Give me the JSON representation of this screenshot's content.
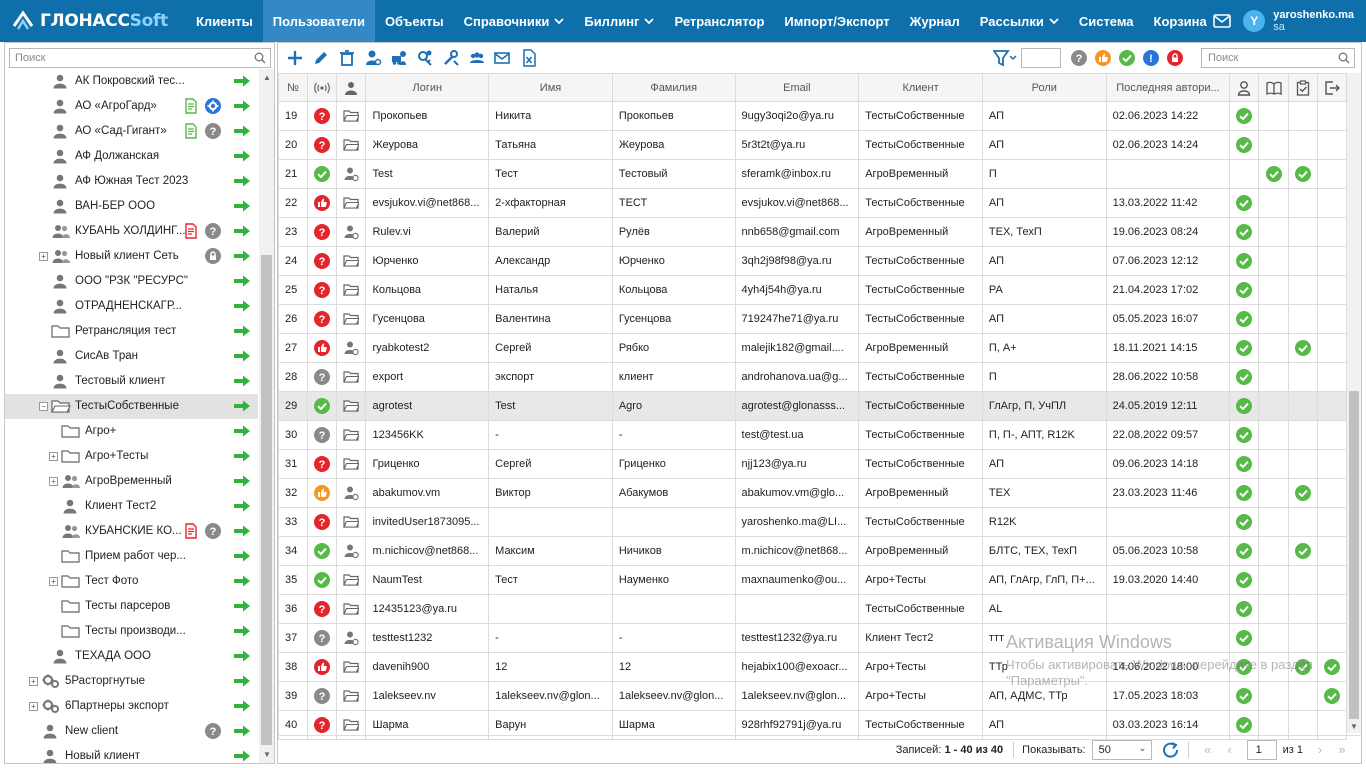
{
  "app": {
    "logo_main": "ГЛОНАСС",
    "logo_soft": "Soft"
  },
  "nav": [
    {
      "label": "Клиенты",
      "active": false,
      "caret": false
    },
    {
      "label": "Пользователи",
      "active": true,
      "caret": false
    },
    {
      "label": "Объекты",
      "active": false,
      "caret": false
    },
    {
      "label": "Справочники",
      "active": false,
      "caret": true
    },
    {
      "label": "Биллинг",
      "active": false,
      "caret": true
    },
    {
      "label": "Ретранслятор",
      "active": false,
      "caret": false
    },
    {
      "label": "Импорт/Экспорт",
      "active": false,
      "caret": false
    },
    {
      "label": "Журнал",
      "active": false,
      "caret": false
    },
    {
      "label": "Рассылки",
      "active": false,
      "caret": true
    },
    {
      "label": "Система",
      "active": false,
      "caret": false
    },
    {
      "label": "Корзина",
      "active": false,
      "caret": false
    }
  ],
  "user": {
    "initial": "Y",
    "name": "yaroshenko.ma",
    "role": "sa"
  },
  "sidebar": {
    "search_placeholder": "Поиск",
    "tree": [
      {
        "label": "АК Покровский тес...",
        "level": 1,
        "icon": "user-gray",
        "expander": "",
        "badges": []
      },
      {
        "label": "АО «АгроГард»",
        "level": 1,
        "icon": "user-gray",
        "expander": "",
        "badges": [
          "doc-green",
          "gear-blue"
        ]
      },
      {
        "label": "АО «Сад-Гигант»",
        "level": 1,
        "icon": "user-gray",
        "expander": "",
        "badges": [
          "doc-green",
          "question-gray"
        ]
      },
      {
        "label": "АФ Должанская",
        "level": 1,
        "icon": "user-gray",
        "expander": "",
        "badges": []
      },
      {
        "label": "АФ Южная Тест 2023",
        "level": 1,
        "icon": "user-gray",
        "expander": "",
        "badges": []
      },
      {
        "label": "ВАН-БЕР ООО",
        "level": 1,
        "icon": "user-gray",
        "expander": "",
        "badges": []
      },
      {
        "label": "КУБАНЬ ХОЛДИНГ...",
        "level": 1,
        "icon": "users-gray",
        "expander": "",
        "badges": [
          "doc-red",
          "question-gray"
        ]
      },
      {
        "label": "Новый клиент Сеть",
        "level": 1,
        "icon": "users-gray",
        "expander": "+",
        "badges": [
          "lock-gray"
        ]
      },
      {
        "label": "ООО \"РЗК \"РЕСУРС\"",
        "level": 1,
        "icon": "user-gray",
        "expander": "",
        "badges": []
      },
      {
        "label": "ОТРАДНЕНСКАГР...",
        "level": 1,
        "icon": "user-gray",
        "expander": "",
        "badges": []
      },
      {
        "label": "Ретрансляция тест",
        "level": 1,
        "icon": "folder",
        "expander": "",
        "badges": []
      },
      {
        "label": "СисАв Тран",
        "level": 1,
        "icon": "user-gray",
        "expander": "",
        "badges": []
      },
      {
        "label": "Тестовый клиент",
        "level": 1,
        "icon": "user-gray",
        "expander": "",
        "badges": []
      },
      {
        "label": "ТестыСобственные",
        "level": 1,
        "icon": "folder-open",
        "expander": "−",
        "badges": [],
        "selected": true
      },
      {
        "label": "Агро+",
        "level": 2,
        "icon": "folder",
        "expander": "",
        "badges": []
      },
      {
        "label": "Агро+Тесты",
        "level": 2,
        "icon": "folder",
        "expander": "+",
        "badges": []
      },
      {
        "label": "АгроВременный",
        "level": 2,
        "icon": "users-gray",
        "expander": "+",
        "badges": []
      },
      {
        "label": "Клиент Тест2",
        "level": 2,
        "icon": "user-gray",
        "expander": "",
        "badges": []
      },
      {
        "label": "КУБАНСКИЕ КО...",
        "level": 2,
        "icon": "users-gray",
        "expander": "",
        "badges": [
          "doc-red",
          "question-gray"
        ]
      },
      {
        "label": "Прием работ чер...",
        "level": 2,
        "icon": "folder",
        "expander": "",
        "badges": []
      },
      {
        "label": "Тест Фото",
        "level": 2,
        "icon": "folder",
        "expander": "+",
        "badges": []
      },
      {
        "label": "Тесты парсеров",
        "level": 2,
        "icon": "folder",
        "expander": "",
        "badges": []
      },
      {
        "label": "Тесты производи...",
        "level": 2,
        "icon": "folder",
        "expander": "",
        "badges": []
      },
      {
        "label": "ТЕХАДА ООО",
        "level": 1,
        "icon": "user-gray",
        "expander": "",
        "badges": []
      },
      {
        "label": "5Расторгнутые",
        "level": 0,
        "icon": "gears",
        "expander": "+",
        "badges": []
      },
      {
        "label": "6Партнеры экспорт",
        "level": 0,
        "icon": "gears",
        "expander": "+",
        "badges": []
      },
      {
        "label": "New client",
        "level": 0,
        "icon": "user-gray",
        "expander": "",
        "badges": [
          "question-gray"
        ]
      },
      {
        "label": "Новый клиент",
        "level": 0,
        "icon": "user-gray",
        "expander": "",
        "badges": []
      }
    ]
  },
  "toolbar": {
    "search_placeholder": "Поиск",
    "icons": [
      "add-icon",
      "edit-icon",
      "delete-icon",
      "user-settings-icon",
      "user-car-icon",
      "user-key-icon",
      "user-tools-icon",
      "users-group-icon",
      "mail-send-icon",
      "excel-export-icon"
    ],
    "status_filters": [
      "question-gray",
      "thumb-orange",
      "check-green",
      "info-blue",
      "lock-red"
    ]
  },
  "grid": {
    "columns": {
      "num": "№",
      "login": "Логин",
      "name": "Имя",
      "surname": "Фамилия",
      "email": "Email",
      "client": "Клиент",
      "roles": "Роли",
      "last_auth": "Последняя автори..."
    },
    "rows": [
      {
        "num": "19",
        "status": "q-red",
        "type": "folder",
        "login": "Прокопьев",
        "name": "Никита",
        "surname": "Прокопьев",
        "email": "9ugy3oqi2o@ya.ru",
        "client": "ТестыСобственные",
        "roles": "АП",
        "last": "02.06.2023 14:22",
        "c1": true,
        "c2": false,
        "c3": false,
        "c4": false
      },
      {
        "num": "20",
        "status": "q-red",
        "type": "folder",
        "login": "Жеурова",
        "name": "Татьяна",
        "surname": "Жеурова",
        "email": "5r3t2t@ya.ru",
        "client": "ТестыСобственные",
        "roles": "АП",
        "last": "02.06.2023 14:24",
        "c1": true,
        "c2": false,
        "c3": false,
        "c4": false
      },
      {
        "num": "21",
        "status": "ok-green",
        "type": "user",
        "login": "Test",
        "name": "Тест",
        "surname": "Тестовый",
        "email": "sferamk@inbox.ru",
        "client": "АгроВременный",
        "roles": "П",
        "last": "",
        "c1": false,
        "c2": true,
        "c3": true,
        "c4": false
      },
      {
        "num": "22",
        "status": "thumb-red",
        "type": "folder",
        "login": "evsjukov.vi@net868...",
        "name": "2-хфакторная",
        "surname": "ТЕСТ",
        "email": "evsjukov.vi@net868...",
        "client": "ТестыСобственные",
        "roles": "АП",
        "last": "13.03.2022 11:42",
        "c1": true,
        "c2": false,
        "c3": false,
        "c4": false
      },
      {
        "num": "23",
        "status": "q-red",
        "type": "user",
        "login": "Rulev.vi",
        "name": "Валерий",
        "surname": "Рулёв",
        "email": "nnb658@gmail.com",
        "client": "АгроВременный",
        "roles": "ТЕХ, ТехП",
        "last": "19.06.2023 08:24",
        "c1": true,
        "c2": false,
        "c3": false,
        "c4": false
      },
      {
        "num": "24",
        "status": "q-red",
        "type": "folder",
        "login": "Юрченко",
        "name": "Александр",
        "surname": "Юрченко",
        "email": "3qh2j98f98@ya.ru",
        "client": "ТестыСобственные",
        "roles": "АП",
        "last": "07.06.2023 12:12",
        "c1": true,
        "c2": false,
        "c3": false,
        "c4": false
      },
      {
        "num": "25",
        "status": "q-red",
        "type": "folder",
        "login": "Кольцова",
        "name": "Наталья",
        "surname": "Кольцова",
        "email": "4yh4j54h@ya.ru",
        "client": "ТестыСобственные",
        "roles": "РА",
        "last": "21.04.2023 17:02",
        "c1": true,
        "c2": false,
        "c3": false,
        "c4": false
      },
      {
        "num": "26",
        "status": "q-red",
        "type": "folder",
        "login": "Гусенцова",
        "name": "Валентина",
        "surname": "Гусенцова",
        "email": "719247he71@ya.ru",
        "client": "ТестыСобственные",
        "roles": "АП",
        "last": "05.05.2023 16:07",
        "c1": true,
        "c2": false,
        "c3": false,
        "c4": false
      },
      {
        "num": "27",
        "status": "thumb-red",
        "type": "user",
        "login": "ryabkotest2",
        "name": "Сергей",
        "surname": "Рябко",
        "email": "malejik182@gmail....",
        "client": "АгроВременный",
        "roles": "П, А+",
        "last": "18.11.2021 14:15",
        "c1": true,
        "c2": false,
        "c3": true,
        "c4": false
      },
      {
        "num": "28",
        "status": "q-gray",
        "type": "folder",
        "login": "export",
        "name": "экспорт",
        "surname": "клиент",
        "email": "androhanova.ua@g...",
        "client": "ТестыСобственные",
        "roles": "П",
        "last": "28.06.2022 10:58",
        "c1": true,
        "c2": false,
        "c3": false,
        "c4": false
      },
      {
        "num": "29",
        "status": "ok-green",
        "type": "folder",
        "login": "agrotest",
        "name": "Test",
        "surname": "Agro",
        "email": "agrotest@glonasss...",
        "client": "ТестыСобственные",
        "roles": "ГлАгр, П, УчПЛ",
        "last": "24.05.2019 12:11",
        "c1": true,
        "c2": false,
        "c3": false,
        "c4": false,
        "selected": true
      },
      {
        "num": "30",
        "status": "q-gray",
        "type": "folder",
        "login": "123456KK",
        "name": "-",
        "surname": "-",
        "email": "test@test.ua",
        "client": "ТестыСобственные",
        "roles": "П, П-, АПТ, R12K",
        "last": "22.08.2022 09:57",
        "c1": true,
        "c2": false,
        "c3": false,
        "c4": false
      },
      {
        "num": "31",
        "status": "q-red",
        "type": "folder",
        "login": "Гриценко",
        "name": "Сергей",
        "surname": "Гриценко",
        "email": "njj123@ya.ru",
        "client": "ТестыСобственные",
        "roles": "АП",
        "last": "09.06.2023 14:18",
        "c1": true,
        "c2": false,
        "c3": false,
        "c4": false
      },
      {
        "num": "32",
        "status": "thumb-orange",
        "type": "user",
        "login": "abakumov.vm",
        "name": "Виктор",
        "surname": "Абакумов",
        "email": "abakumov.vm@glo...",
        "client": "АгроВременный",
        "roles": "ТЕХ",
        "last": "23.03.2023 11:46",
        "c1": true,
        "c2": false,
        "c3": true,
        "c4": false
      },
      {
        "num": "33",
        "status": "q-red",
        "type": "folder",
        "login": "invitedUser1873095...",
        "name": "",
        "surname": "",
        "email": "yaroshenko.ma@LI...",
        "client": "ТестыСобственные",
        "roles": "R12K",
        "last": "",
        "c1": true,
        "c2": false,
        "c3": false,
        "c4": false
      },
      {
        "num": "34",
        "status": "ok-green",
        "type": "user",
        "login": "m.nichicov@net868...",
        "name": "Максим",
        "surname": "Ничиков",
        "email": "m.nichicov@net868...",
        "client": "АгроВременный",
        "roles": "БЛТС, ТЕХ, ТехП",
        "last": "05.06.2023 10:58",
        "c1": true,
        "c2": false,
        "c3": true,
        "c4": false
      },
      {
        "num": "35",
        "status": "ok-green",
        "type": "folder",
        "login": "NaumTest",
        "name": "Тест",
        "surname": "Науменко",
        "email": "maxnaumenko@ou...",
        "client": "Агро+Тесты",
        "roles": "АП, ГлАгр, ГлП, П+...",
        "last": "19.03.2020 14:40",
        "c1": true,
        "c2": false,
        "c3": false,
        "c4": false
      },
      {
        "num": "36",
        "status": "q-red",
        "type": "folder",
        "login": "12435123@ya.ru",
        "name": "",
        "surname": "",
        "email": "",
        "client": "ТестыСобственные",
        "roles": "AL",
        "last": "",
        "c1": true,
        "c2": false,
        "c3": false,
        "c4": false
      },
      {
        "num": "37",
        "status": "q-gray",
        "type": "user",
        "login": "testtest1232",
        "name": "-",
        "surname": "-",
        "email": "testtest1232@ya.ru",
        "client": "Клиент Тест2",
        "roles": "ттт",
        "last": "",
        "c1": true,
        "c2": false,
        "c3": false,
        "c4": false
      },
      {
        "num": "38",
        "status": "thumb-red",
        "type": "folder",
        "login": "davenih900",
        "name": "12",
        "surname": "12",
        "email": "hejabix100@exoacr...",
        "client": "Агро+Тесты",
        "roles": "ТТр",
        "last": "14.06.2022 18:00",
        "c1": true,
        "c2": false,
        "c3": true,
        "c4": true
      },
      {
        "num": "39",
        "status": "q-gray",
        "type": "folder",
        "login": "1alekseev.nv",
        "name": "1alekseev.nv@glon...",
        "surname": "1alekseev.nv@glon...",
        "email": "1alekseev.nv@glon...",
        "client": "Агро+Тесты",
        "roles": "АП, АДМС, ТТр",
        "last": "17.05.2023 18:03",
        "c1": true,
        "c2": false,
        "c3": false,
        "c4": true
      },
      {
        "num": "40",
        "status": "q-red",
        "type": "folder",
        "login": "Шарма",
        "name": "Варун",
        "surname": "Шарма",
        "email": "928rhf92791j@ya.ru",
        "client": "ТестыСобственные",
        "roles": "АП",
        "last": "03.03.2023 16:14",
        "c1": true,
        "c2": false,
        "c3": false,
        "c4": false
      }
    ]
  },
  "footer": {
    "records_label": "Записей:",
    "records_range": "1 - 40 из",
    "records_total": "40",
    "show_label": "Показывать:",
    "page_size": "50",
    "page": "1",
    "of_pages": "из 1"
  },
  "watermark": {
    "title": "Активация Windows",
    "subtitle": "Чтобы активировать Windows, перейдите в раздел \"Параметры\"."
  },
  "colors": {
    "topbar": "#0e6faa",
    "active_tab": "#3289c4",
    "green": "#57b947",
    "red": "#e3262c",
    "orange": "#f6961e",
    "blue": "#2a74d9",
    "gray": "#8a8a8a",
    "arrow_green": "#31b43f"
  }
}
